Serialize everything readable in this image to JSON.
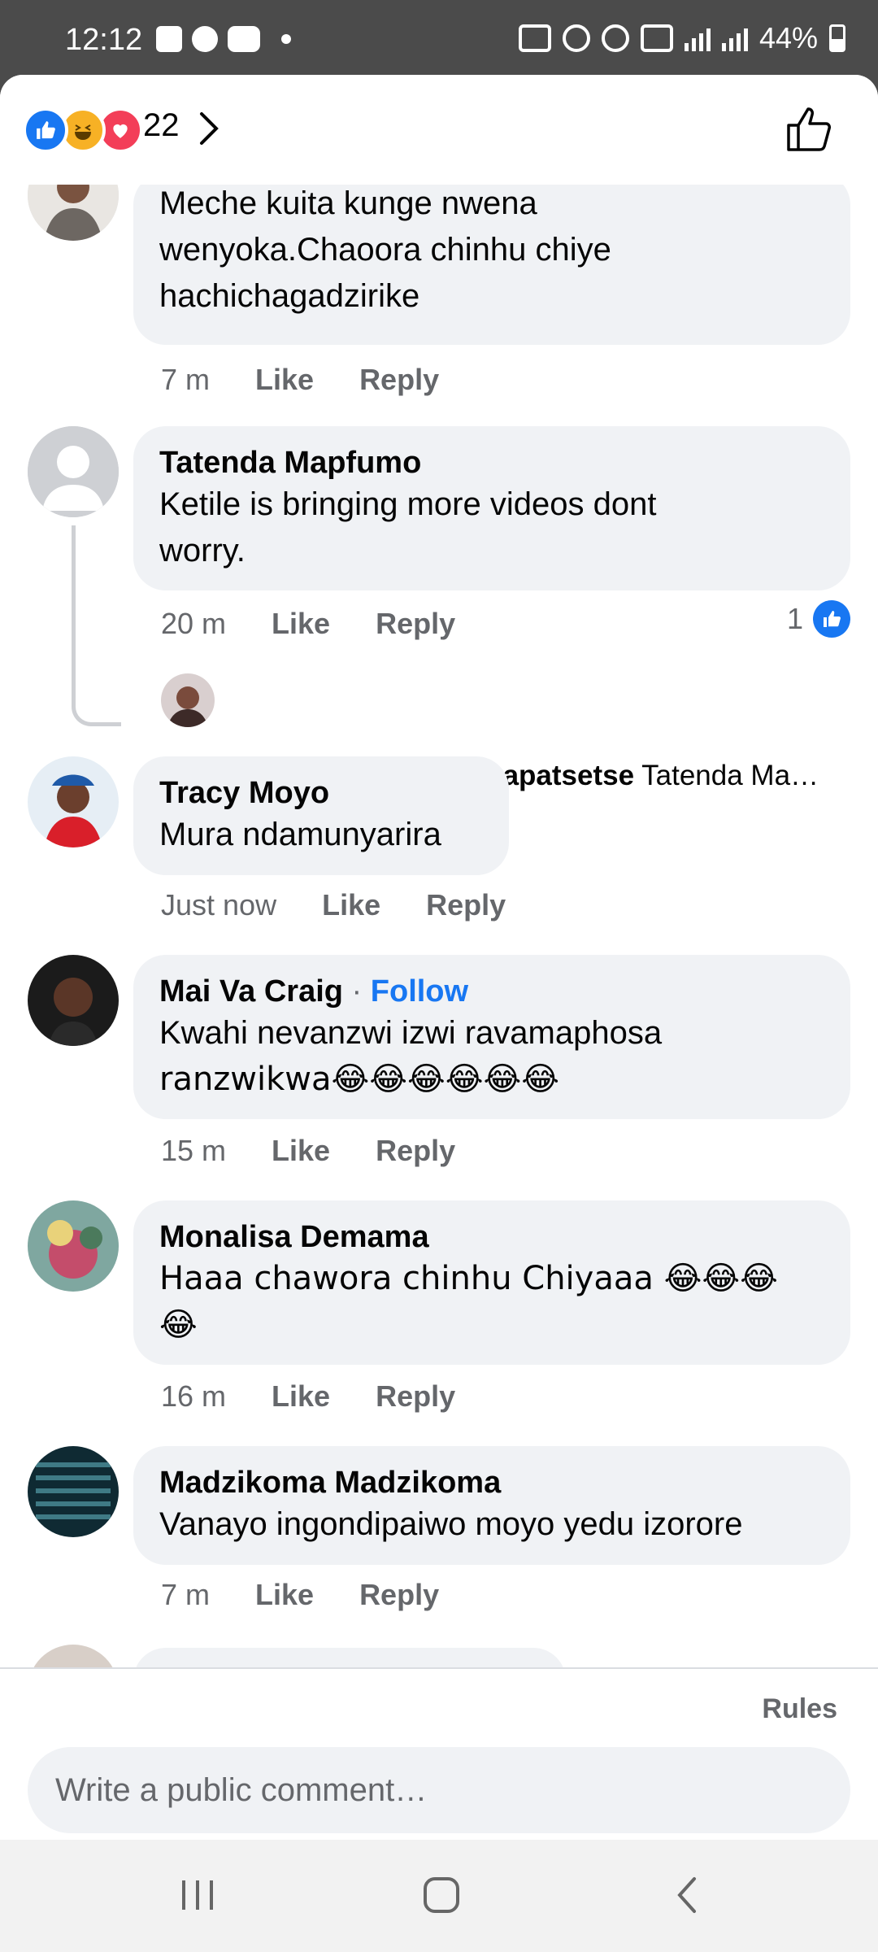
{
  "status_bar": {
    "time": "12:12",
    "battery": "44%"
  },
  "reactions": {
    "count": "22",
    "colors": {
      "like": "#1877f2",
      "haha": "#f7b125",
      "love": "#f33e58"
    }
  },
  "comments": [
    {
      "name": "",
      "text_lines": [
        "Meche kuita kunge nwena",
        "wenyoka.Chaoora chinhu chiye",
        "hachichagadzirike"
      ],
      "time": "7 m",
      "like": "Like",
      "reply": "Reply"
    },
    {
      "name": "Tatenda Mapfumo",
      "text_lines": [
        "Ketile is bringing more videos dont",
        "worry."
      ],
      "time": "20 m",
      "like": "Like",
      "reply": "Reply",
      "like_count": "1",
      "reply_preview": {
        "name": "Kunya Huguta Mharapatsetse",
        "text": "Tatenda Ma…"
      }
    },
    {
      "name": "Tracy Moyo",
      "text_lines": [
        "Mura ndamunyarira"
      ],
      "time": "Just now",
      "like": "Like",
      "reply": "Reply"
    },
    {
      "name": "Mai Va Craig",
      "follow": "Follow",
      "text_lines": [
        "Kwahi nevanzwi izwi ravamaphosa",
        "ranzwikwa😂😂😂😂😂😂"
      ],
      "time": "15 m",
      "like": "Like",
      "reply": "Reply"
    },
    {
      "name": "Monalisa Demama",
      "text_lines": [
        "Haaa chawora chinhu Chiyaaa 😂😂😂",
        "😂"
      ],
      "time": "16 m",
      "like": "Like",
      "reply": "Reply"
    },
    {
      "name": "Madzikoma Madzikoma",
      "text_lines": [
        "Vanayo  ingondipaiwo moyo yedu izorore"
      ],
      "time": "7 m",
      "like": "Like",
      "reply": "Reply"
    }
  ],
  "footer": {
    "rules": "Rules",
    "placeholder": "Write a public comment…"
  }
}
